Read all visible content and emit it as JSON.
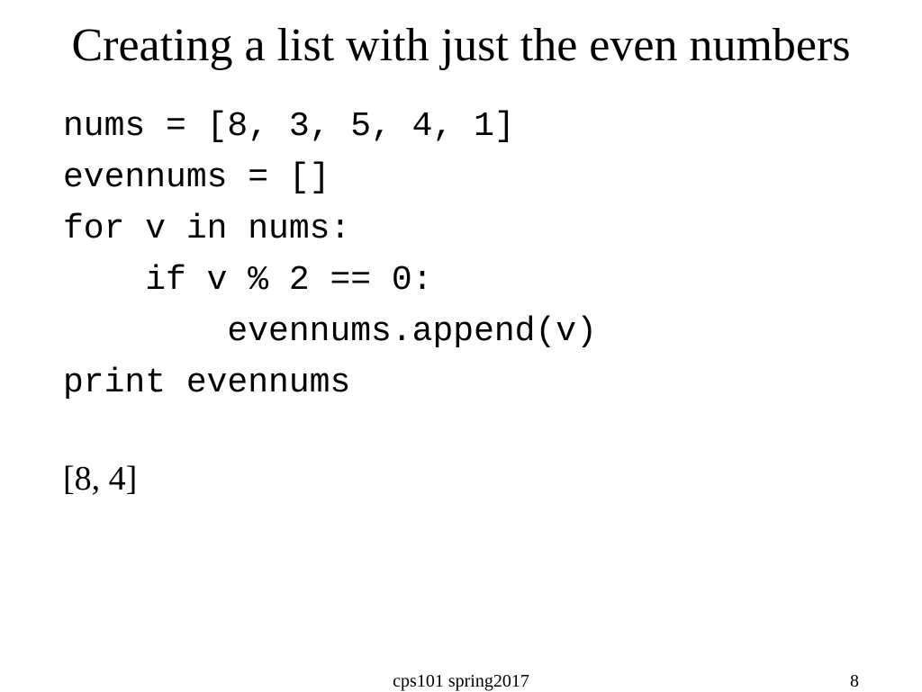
{
  "slide": {
    "title": "Creating a list with just the even numbers",
    "code_lines": [
      "nums = [8, 3, 5, 4, 1]",
      "evennums = []",
      "for v in nums:",
      "    if v % 2 == 0:",
      "        evennums.append(v)",
      "print evennums"
    ],
    "output": "[8, 4]",
    "footer_center": "cps101 spring2017",
    "footer_right": "8"
  }
}
